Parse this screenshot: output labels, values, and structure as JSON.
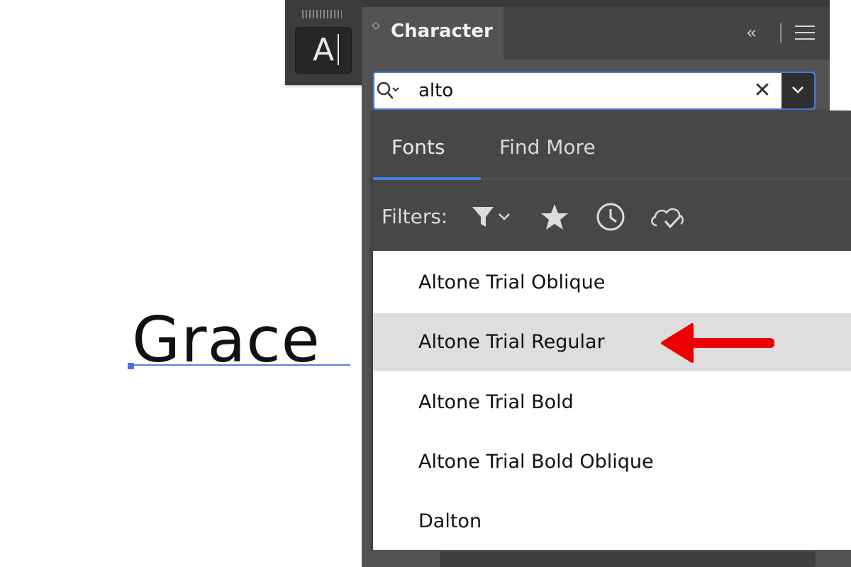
{
  "canvas": {
    "text": "Grace"
  },
  "toolbar": {
    "type_tool_glyph": "A"
  },
  "panel": {
    "title": "Character",
    "collapse_glyph": "‹‹"
  },
  "search": {
    "value": "alto",
    "clear_glyph": "✕"
  },
  "font_tabs": {
    "fonts": "Fonts",
    "find_more": "Find More"
  },
  "filters": {
    "label": "Filters:",
    "icons": [
      "filter-icon",
      "star-icon",
      "clock-icon",
      "cloud-check-icon"
    ]
  },
  "font_list": {
    "items": [
      {
        "label": "Altone Trial Oblique",
        "selected": false
      },
      {
        "label": "Altone Trial Regular",
        "selected": true
      },
      {
        "label": "Altone Trial Bold",
        "selected": false
      },
      {
        "label": "Altone Trial Bold Oblique",
        "selected": false
      },
      {
        "label": "Dalton",
        "selected": false
      }
    ]
  },
  "colors": {
    "panel_bg": "#535353",
    "accent_blue": "#3f7fe0",
    "selected_row": "#dedede",
    "arrow_red": "#ee0000"
  }
}
